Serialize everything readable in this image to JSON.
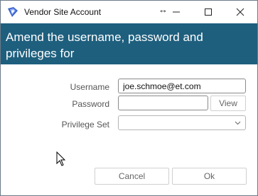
{
  "window": {
    "title": "Vendor Site Account",
    "resize_glyph": "↔",
    "controls": [
      "minimize-icon",
      "maximize-icon",
      "close-icon"
    ],
    "app_icon": "vendor-shield-icon"
  },
  "banner": {
    "text": "Amend the username, password and privileges for",
    "background": "#1e5f7e"
  },
  "form": {
    "username_label": "Username",
    "username_value": "joe.schmoe@et.com",
    "password_label": "Password",
    "password_value": "",
    "view_label": "View",
    "privilege_label": "Privilege Set",
    "privilege_value": ""
  },
  "footer": {
    "cancel_label": "Cancel",
    "ok_label": "Ok"
  }
}
